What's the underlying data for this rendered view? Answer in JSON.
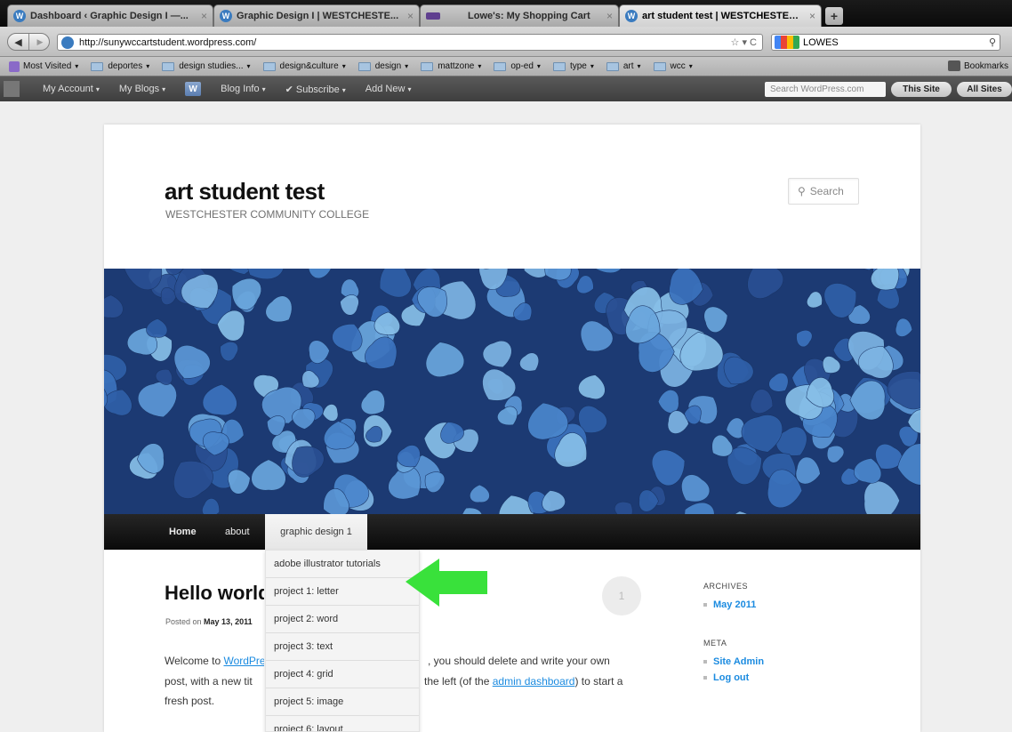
{
  "browser": {
    "tabs": [
      {
        "label": "Dashboard ‹ Graphic Design I —...",
        "active": false
      },
      {
        "label": "Graphic Design I | WESTCHESTE...",
        "active": false
      },
      {
        "label": "Lowe's: My Shopping Cart",
        "active": false
      },
      {
        "label": "art student test | WESTCHESTER...",
        "active": true
      }
    ],
    "tab_close_glyph": "×",
    "new_tab_glyph": "+",
    "url": "http://sunywccartstudent.wordpress.com/",
    "search_query": "LOWES",
    "bookmarks": [
      "deportes",
      "design studies...",
      "design&culture",
      "design",
      "mattzone",
      "op-ed",
      "type",
      "art",
      "wcc"
    ],
    "most_visited": "Most Visited",
    "bookmarks_menu": "Bookmarks"
  },
  "admin_bar": {
    "items": [
      "My Account",
      "My Blogs",
      "Blog Info",
      "Subscribe",
      "Add New"
    ],
    "search_placeholder": "Search WordPress.com",
    "this_site": "This Site",
    "all_sites": "All Sites"
  },
  "site": {
    "title": "art student test",
    "description": "WESTCHESTER COMMUNITY COLLEGE",
    "search_placeholder": "Search"
  },
  "menu": {
    "items": [
      "Home",
      "about",
      "graphic design 1"
    ],
    "submenu": [
      "adobe illustrator tutorials",
      "project 1: letter",
      "project 2: word",
      "project 3: text",
      "project 4: grid",
      "project 5: image",
      "project 6: layout"
    ]
  },
  "post": {
    "title": "Hello world!",
    "posted_on_label": "Posted on",
    "date": "May 13, 2011",
    "comment_count": "1",
    "line1_prefix": "Welcome to ",
    "line1_link": "WordPress.com",
    "line1_tail": ", you should delete and write your own",
    "line2_prefix": "post, with a new tit",
    "line2_tail": "the left (of the ",
    "line2_link": "admin dashboard",
    "line2_end": ") to start a",
    "line3": "fresh post."
  },
  "sidebar": {
    "archives_title": "ARCHIVES",
    "archives": [
      "May 2011"
    ],
    "meta_title": "META",
    "meta": [
      "Site Admin",
      "Log out"
    ]
  },
  "colors": {
    "link": "#1b8be0",
    "arrow": "#39e13b",
    "menu_bar": "#111111",
    "header_image_base": "#1c3a73"
  }
}
